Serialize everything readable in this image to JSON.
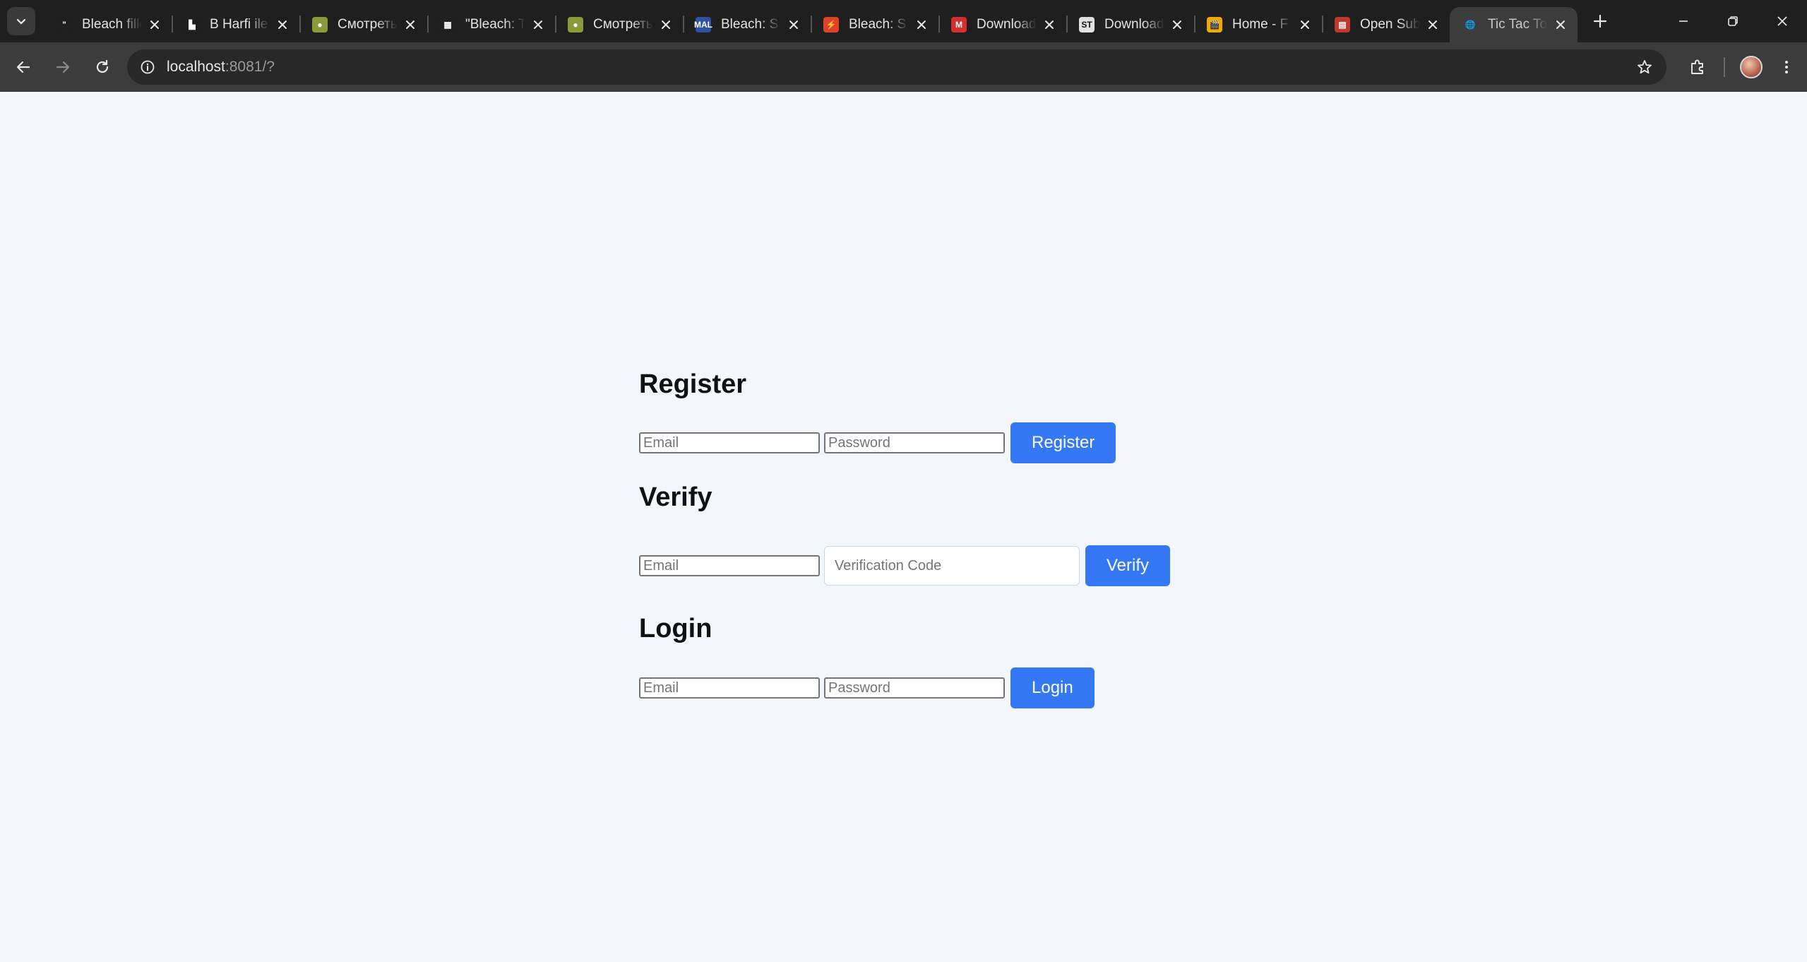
{
  "browser": {
    "tabs": [
      {
        "title": "Bleach filler",
        "favicon": "bleach-favicon",
        "fav_text": "\"",
        "fav_color": "#1f1f1f"
      },
      {
        "title": "B Harfi ile",
        "favicon": "castle-favicon",
        "fav_text": "▙",
        "fav_color": "#1f1f1f"
      },
      {
        "title": "Смотреть",
        "favicon": "anime-favicon",
        "fav_text": "●",
        "fav_color": "#8a9a3a"
      },
      {
        "title": "\"Bleach: T",
        "favicon": "grid-favicon",
        "fav_text": "▦",
        "fav_color": "#1f1f1f"
      },
      {
        "title": "Смотреть",
        "favicon": "anime-favicon",
        "fav_text": "●",
        "fav_color": "#8a9a3a"
      },
      {
        "title": "Bleach: S",
        "favicon": "mal-favicon",
        "fav_text": "MAL",
        "fav_color": "#2e51a2"
      },
      {
        "title": "Bleach: S",
        "favicon": "red-circle-favicon",
        "fav_text": "⚡",
        "fav_color": "#e0412b"
      },
      {
        "title": "Download",
        "favicon": "m-favicon",
        "fav_text": "M",
        "fav_color": "#d32f2f"
      },
      {
        "title": "Download",
        "favicon": "st-favicon",
        "fav_text": "ST",
        "fav_color": "#e0e0e0"
      },
      {
        "title": "Home - F",
        "favicon": "clapper-favicon",
        "fav_text": "🎬",
        "fav_color": "#f2a900"
      },
      {
        "title": "Open Sub",
        "favicon": "opensub-favicon",
        "fav_text": "▤",
        "fav_color": "#c0392b"
      },
      {
        "title": "Tic Tac To",
        "favicon": "globe-favicon",
        "fav_text": "🌐",
        "fav_color": "#3c3c3c",
        "active": true
      }
    ],
    "url_host": "localhost",
    "url_rest": ":8081/?"
  },
  "register": {
    "heading": "Register",
    "email_placeholder": "Email",
    "password_placeholder": "Password",
    "button": "Register"
  },
  "verify": {
    "heading": "Verify",
    "email_placeholder": "Email",
    "code_placeholder": "Verification Code",
    "button": "Verify"
  },
  "login": {
    "heading": "Login",
    "email_placeholder": "Email",
    "password_placeholder": "Password",
    "button": "Login"
  },
  "colors": {
    "page_background": "#f3f7fc",
    "button_primary": "#3478f6",
    "browser_frame": "#1f1f1f",
    "toolbar": "#3c3c3c"
  }
}
